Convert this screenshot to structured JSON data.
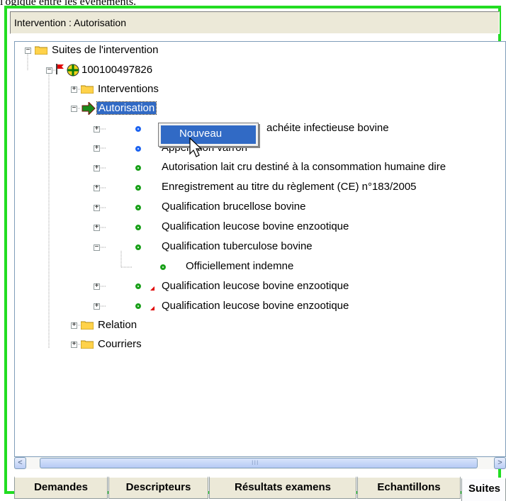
{
  "top_text": "l'ogique entre les évènements.",
  "title": "Intervention : Autorisation",
  "tree": {
    "root": "Suites de l'intervention",
    "node_id": "100100497826",
    "interventions": "Interventions",
    "autorisation": "Autorisation",
    "items": [
      {
        "label": "achéite infectieuse bovine",
        "status": "blue"
      },
      {
        "label": "Appellation varron",
        "status": "blue"
      },
      {
        "label": "Autorisation lait cru destiné à la consommation humaine dire",
        "status": "green"
      },
      {
        "label": "Enregistrement au titre du règlement (CE) n°183/2005",
        "status": "green"
      },
      {
        "label": "Qualification brucellose bovine",
        "status": "green"
      },
      {
        "label": "Qualification leucose bovine enzootique",
        "status": "green"
      },
      {
        "label": "Qualification tuberculose bovine",
        "status": "green"
      },
      {
        "label": "Officiellement indemne",
        "status": "green"
      },
      {
        "label": "Qualification leucose bovine enzootique",
        "status": "green-red"
      },
      {
        "label": "Qualification leucose bovine enzootique",
        "status": "green-red"
      }
    ],
    "relation": "Relation",
    "courriers": "Courriers"
  },
  "context_menu": {
    "item": "Nouveau"
  },
  "scrollbar": {
    "left_arrow": "<",
    "right_arrow": ">",
    "grip": "III"
  },
  "tabs": [
    "Demandes",
    "Descripteurs",
    "Résultats examens",
    "Echantillons",
    "Suites"
  ],
  "active_tab": "Suites",
  "colors": {
    "frame": "#22dd22",
    "selection": "#316ac5",
    "status_blue": "#1e64f0",
    "status_green": "#1aa01a"
  }
}
